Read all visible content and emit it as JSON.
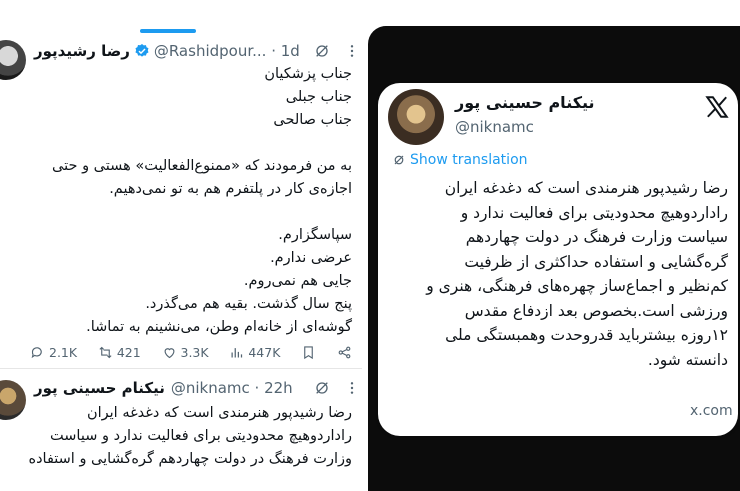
{
  "left_feed": {
    "tweet1": {
      "name": "رضا رشیدپور",
      "handle_time": "@Rashidpour... · 1d",
      "verified": true,
      "lines_a": [
        "جناب پزشکیان",
        "جناب جبلی",
        "جناب صالحی"
      ],
      "lines_b": [
        "به من فرمودند که «ممنوع‌الفعالیت» هستی و حتی",
        "اجازه‌ی کار در پلتفرم هم به تو نمی‌دهیم."
      ],
      "lines_c": [
        "سپاسگزارم.",
        "عرضی ندارم.",
        "جایی هم نمی‌روم.",
        "پنج سال گذشت. بقیه هم می‌گذرد.",
        "گوشه‌ای از خانه‌ام وطن، می‌نشینم به تماشا."
      ],
      "stats": {
        "replies": "2.1K",
        "reposts": "421",
        "likes": "3.3K",
        "views": "447K"
      }
    },
    "tweet2": {
      "name": "نیکنام حسینی پور",
      "handle_time": "@niknamc · 22h",
      "lines": [
        "رضا رشیدپور هنرمندی است که دغدغه ایران",
        "رادارد‌وهیچ محدودیتی برای فعالیت ندارد و سیاست",
        "وزارت فرهنگ در دولت چهاردهم گره‌گشایی و استفاده"
      ]
    }
  },
  "card": {
    "name": "نیکنام حسینی پور",
    "handle": "@niknamc",
    "show_translation": "Show translation",
    "lines": [
      "رضا رشیدپور هنرمندی است که دغدغه ایران",
      "رادارد‌وهیچ محدودیتی برای فعالیت ندارد و",
      "سیاست وزارت فرهنگ در دولت چهاردهم",
      "گره‌گشایی و استفاده حداکثری از ظرفیت",
      "کم‌نظیر و اجماع‌ساز چهره‌های فرهنگی، هنری و",
      "ورزشی است.بخصوص بعد ازدفاع مقدس",
      "۱۲روزه بیشترباید قدروحدت وهمبستگی ملی",
      "دانسته شود."
    ],
    "domain": "x.com"
  },
  "colors": {
    "accent": "#1d9bf0",
    "text": "#0f1419",
    "muted": "#536471",
    "dark_bg": "#0c0c0c"
  }
}
